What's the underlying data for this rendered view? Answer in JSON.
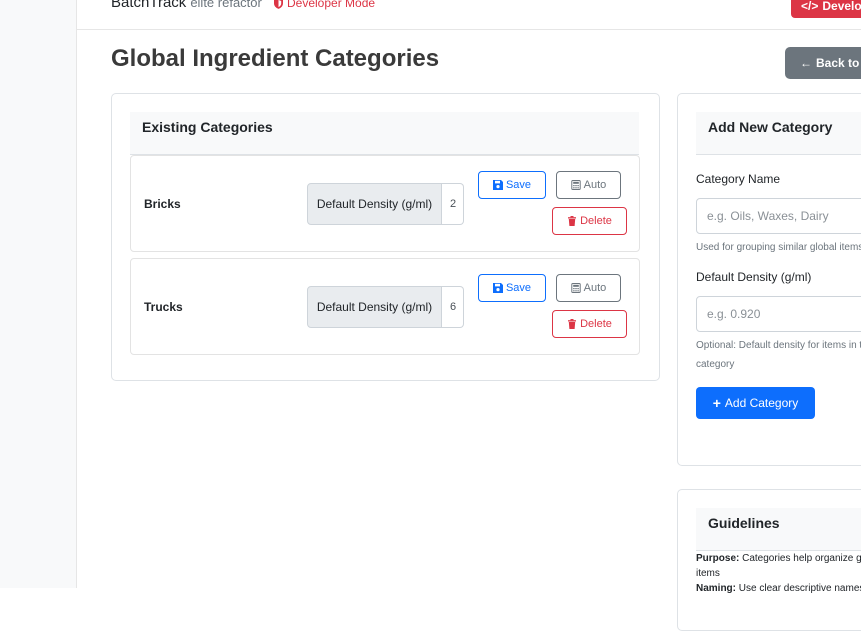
{
  "topbar": {
    "brand": "BatchTrack",
    "brand_sub": "elite refactor",
    "dev_mode": "Developer Mode",
    "dev_button": "Developer"
  },
  "page": {
    "title": "Global Ingredient Categories",
    "back_button": "Back to Categories"
  },
  "existing": {
    "header": "Existing Categories",
    "rows": [
      {
        "name": "Bricks",
        "density_label": "Default Density (g/ml)",
        "density_value": "2",
        "save": "Save",
        "auto": "Auto",
        "delete": "Delete"
      },
      {
        "name": "Trucks",
        "density_label": "Default Density (g/ml)",
        "density_value": "6",
        "save": "Save",
        "auto": "Auto",
        "delete": "Delete"
      }
    ]
  },
  "add_form": {
    "header": "Add New Category",
    "name_label": "Category Name",
    "name_placeholder": "e.g. Oils, Waxes, Dairy",
    "name_help": "Used for grouping similar global items",
    "density_label": "Default Density (g/ml)",
    "density_placeholder": "e.g. 0.920",
    "density_help": "Optional: Default density for items in this category",
    "submit": "Add Category"
  },
  "guidelines": {
    "header": "Guidelines",
    "purpose_label": "Purpose:",
    "purpose_text": "Categories help organize global items",
    "naming_label": "Naming:",
    "naming_text": "Use clear descriptive names"
  },
  "colors": {
    "primary": "#0d6efd",
    "danger": "#dc3545",
    "secondary": "#6c757d"
  }
}
